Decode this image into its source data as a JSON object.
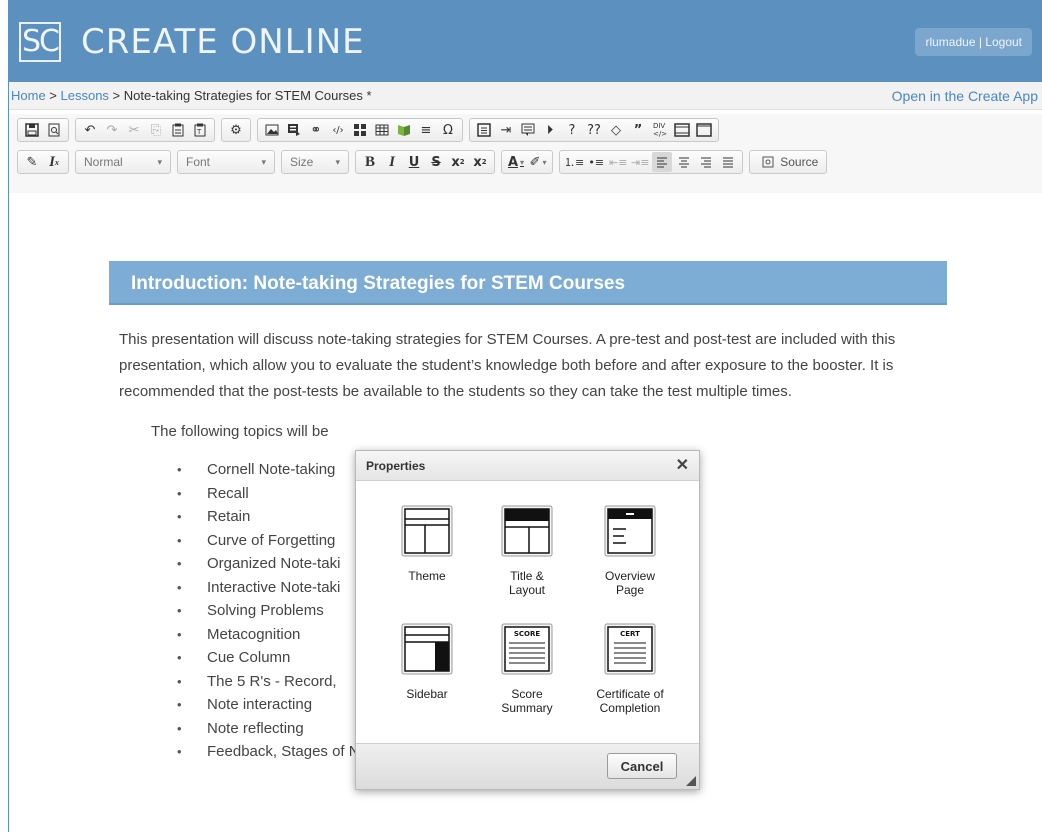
{
  "header": {
    "logo_text": "SC",
    "title": "CREATE ONLINE",
    "user_name": "rlumadue",
    "separator": " | ",
    "logout_label": "Logout"
  },
  "breadcrumb": {
    "home": "Home",
    "sep1": " > ",
    "lessons": "Lessons",
    "sep2": " > ",
    "current": "Note-taking Strategies for STEM Courses *"
  },
  "open_app_label": "Open in the Create App",
  "toolbar": {
    "format_label": "Normal",
    "font_label": "Font",
    "size_label": "Size",
    "source_label": "Source",
    "icons_row1": [
      "save-icon",
      "preview-icon",
      "undo-icon",
      "redo-icon",
      "cut-icon",
      "copy-icon",
      "paste-icon",
      "paste-text-icon",
      "settings-icon",
      "image-icon",
      "flash-icon",
      "link-icon",
      "code-icon",
      "layout-icon",
      "table-icon",
      "glossary-icon",
      "horizontal-rule-icon",
      "special-char-icon",
      "template-icon",
      "indent-list-icon",
      "comment-icon",
      "media-icon",
      "question-icon",
      "questions-icon",
      "embed-icon",
      "quote-icon",
      "div-icon",
      "frame-icon",
      "page-icon"
    ],
    "icons_row2": [
      "brush-icon",
      "clear-format-icon",
      "bold-icon",
      "italic-icon",
      "underline-icon",
      "strike-icon",
      "subscript-icon",
      "superscript-icon",
      "text-color-icon",
      "highlight-icon",
      "numbered-list-icon",
      "bulleted-list-icon",
      "outdent-icon",
      "indent-icon",
      "align-left-icon",
      "align-center-icon",
      "align-right-icon",
      "justify-icon",
      "source-icon"
    ]
  },
  "document": {
    "heading": "Introduction: Note-taking Strategies for STEM Courses",
    "paragraph": "This presentation will discuss note-taking strategies for STEM Courses.  A pre-test and post-test are included with this presentation, which allow you to evaluate the student’s knowledge both before and after exposure to the booster. It is recommended that the post-tests be available to the students so they can take the test multiple times.",
    "intro": "The following topics will be",
    "topics": [
      "Cornell Note-taking",
      "Recall",
      "Retain",
      "Curve of Forgetting",
      "Organized Note-taki",
      "Interactive Note-taki",
      "Solving Problems",
      "Metacognition",
      "Cue Column",
      "The 5 R's - Record,",
      "Note interacting",
      "Note reflecting",
      "Feedback, Stages of Note-taking"
    ]
  },
  "dialog": {
    "title": "Properties",
    "close_glyph": "✕",
    "options": [
      {
        "label": "Theme",
        "icon": "theme-icon"
      },
      {
        "label": "Title &\nLayout",
        "icon": "title-layout-icon"
      },
      {
        "label": "Overview\nPage",
        "icon": "overview-page-icon"
      },
      {
        "label": "Sidebar",
        "icon": "sidebar-icon"
      },
      {
        "label": "Score\nSummary",
        "icon": "score-summary-icon",
        "icon_text": "SCORE"
      },
      {
        "label": "Certificate of\nCompletion",
        "icon": "certificate-icon",
        "icon_text": "CERT"
      }
    ],
    "cancel_label": "Cancel"
  }
}
